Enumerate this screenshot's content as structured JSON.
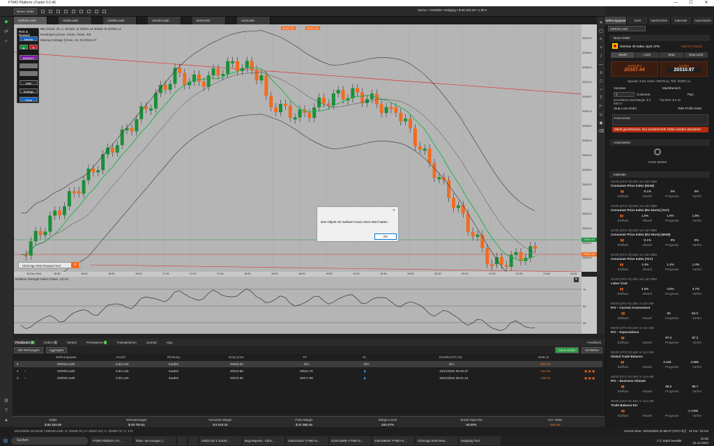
{
  "window": {
    "title": "FTMO Platform cTrader 5.0.46",
    "minimize": "—",
    "maximize": "☐",
    "close": "✕"
  },
  "toolbar": {
    "new_order": "Neuer Order",
    "account": "Demo • 7322556 • Hedging • $ 50 263.49 • 1:30 ▾"
  },
  "chart_tabs": [
    "GER40.cash",
    "US30.cash",
    "US500.cash",
    "US100.cash",
    "EURUSD",
    "XAUUSD"
  ],
  "chart": {
    "legend1": "BB (Close, 20, 2, Simple, 0)  20321.44  20350.75  20292.14",
    "legend2": "Envelopes (Close, Close, Close, 20)",
    "legend3": "Moving Average (Close, 14, 0)  20315.47",
    "price_labels": [
      "20392.0",
      "20386.0",
      "20380.0",
      "20374.0",
      "20368.0",
      "20362.0",
      "20356.0",
      "20350.0",
      "20344.0",
      "20338.0",
      "20332.0",
      "20326.0",
      "20320.0",
      "20314.0",
      "20308.0",
      "20302.0"
    ],
    "time_labels": [
      "16 Dec 2024",
      "15:45",
      "16:05",
      "16:25",
      "16:45",
      "17:05",
      "17:25",
      "17:45",
      "18:05",
      "18:25",
      "18:45",
      "19:05",
      "19:25",
      "19:45",
      "20:05",
      "20:25",
      "20:45",
      "21:05",
      "21:25",
      "21:45",
      "22:05"
    ],
    "bid_tag": "20307.44",
    "ask_tag": "20310.97",
    "top_tag1": "20367.42",
    "top_tag2": "20310.00"
  },
  "risk_reward": {
    "title": "Risk & Reward",
    "buttons": [
      "Market",
      "▲",
      "▼",
      "MARKET",
      "",
      "",
      "Hide",
      "Settings",
      "Close"
    ]
  },
  "overlay": {
    "label": "ClickAlgo Risk Reward Tool",
    "close": "✕"
  },
  "rsi": {
    "title": "Relative Strength Index (Close, 14)  51",
    "labels": [
      "70",
      "50",
      "30"
    ]
  },
  "dialog": {
    "message": "Das Objekt mit Nullwert muss einen Wert haben.",
    "ok": "OK",
    "close": "✕"
  },
  "bottom_tabs": [
    {
      "label": "Positionen",
      "badge": "3"
    },
    {
      "label": "Orders",
      "badge": "0"
    },
    {
      "label": "Verlauf",
      "badge": ""
    },
    {
      "label": "Preisalarme",
      "badge": "2"
    },
    {
      "label": "Transaktionen",
      "badge": ""
    },
    {
      "label": "Journal",
      "badge": ""
    },
    {
      "label": "Algo",
      "badge": ""
    }
  ],
  "feedback": "Feedback",
  "filters": {
    "direction": "Alle Richtungen",
    "grouping": "Aggregiert",
    "new_order": "Neue Order",
    "close": "Schließen"
  },
  "positions": {
    "headers": [
      "Währungspaar",
      "Anzahl",
      "Richtung",
      "Entry price",
      "TP",
      "SL",
      "Erstellt (UTC+0)",
      "Netto $"
    ],
    "rows": [
      [
        "GER40.cash",
        "5.60 Lots",
        "Kaufen",
        "20403.04",
        "N/A",
        "N/A",
        "N/A",
        "-962.06"
      ],
      [
        "GER40.cash",
        "3.60 Lots",
        "Kaufen",
        "20419.68",
        "20521.76",
        "",
        "16/12/2024 05:45:37",
        "-424.66"
      ],
      [
        "GER40.cash",
        "2.00 Lots",
        "Kaufen",
        "20373.06",
        "20477.99",
        "",
        "16/12/2024 08:01:44",
        "-138.03"
      ]
    ]
  },
  "footer": {
    "labels": [
      "Saldo",
      "Reinvermögen",
      "Genutzte Margin",
      "Freie Margin",
      "Margin-Level",
      "Smart Stop-Out",
      "Unr. Netto"
    ],
    "values": [
      "$ 50 263.49",
      "$ 49 700.61",
      "$ 8 010.16",
      "$ 41 690.45",
      "620.47%",
      "50.00%",
      "-562.88"
    ]
  },
  "status": "16/12/2024 16:15:50 | GER40.cash: O: 20349.75 | H: 20347.23 | C: 20348.73 | V: 172",
  "current_time": "Current time: 16/12/2024 21:55:47 (UTC+0)  ▏ 12 ms / 16 ms",
  "right_panel": {
    "tabs": [
      "Währungspaar",
      "DoM",
      "Nachrichten",
      "Kalender",
      "Autochartist"
    ],
    "symbol": "GER40.cash",
    "new_order": "Neue Order",
    "instrument": "German 40 Index, Spot CFD",
    "change": "-102.0 (-0.51%)",
    "order_types": [
      "Markt",
      "Limit",
      "Stop",
      "Stop-Limit"
    ],
    "sell_label": "Verkaufen",
    "sell_price": "20307.44",
    "buy_label": "Kaufen",
    "buy_price": "20310.97",
    "spread": "Spread: 3.53, Hoch: 20479.xx, Tief: 20297.xx",
    "volume_label": "Volumen",
    "volume": "2",
    "volume_unit": "Contracts",
    "pips_label": "Pips",
    "market_range": "Marktbereich",
    "margin_line": "Geschätzte Kauf-Margin: $ 2 845.47",
    "pip_value": "Pip-Wert: $ 2.10",
    "stop_loss": "Stop-Loss-Order",
    "take_profit": "Take-Profit-Order",
    "comment_label": "Kommentar",
    "market_closed": "Markt geschlossen. Nur ausstehende Order werden akzeptiert.",
    "autochartist": "Autochartist",
    "no_pattern": "Keine Muster",
    "calendar": "Kalender",
    "events": [
      {
        "time": "10:00 (UTC+0) Zeit: vor 11h 55M",
        "name": "Consumer Price Index (MoM)",
        "v": [
          "-0.1%",
          "0%",
          "0%"
        ]
      },
      {
        "time": "10:00 (UTC+0) Zeit: vor 11h 55M",
        "name": "Consumer Price Index (EU Norm) (YoY)",
        "v": [
          "1.5%",
          "1.6%",
          "1.8%"
        ]
      },
      {
        "time": "10:00 (UTC+0) Zeit: vor 11h 55M",
        "name": "Consumer Price Index (EU Norm) (MoM)",
        "v": [
          "-0.1%",
          "0%",
          "0%"
        ]
      },
      {
        "time": "10:00 (UTC+0) Zeit: vor 11h 55M",
        "name": "Consumer Price Index (YoY)",
        "v": [
          "1.4%",
          "1.4%",
          "1.4%"
        ]
      },
      {
        "time": "10:00 (UTC+0) Zeit: vor 11h 55M",
        "name": "Labor Cost",
        "v": [
          "4.6%",
          "4.6%",
          "4.7%"
        ]
      },
      {
        "time": "09:00 (UTC+0) Zeit: in 11H 4M",
        "name": "IFO – Current Assessment",
        "v": [
          "",
          "84",
          "84.3"
        ]
      },
      {
        "time": "09:00 (UTC+0) Zeit: in 11H 4M",
        "name": "IFO – Expectations",
        "v": [
          "",
          "87.5",
          "87.2"
        ]
      },
      {
        "time": "09:00 (UTC+0) Zeit: in 11H 4M",
        "name": "Global Trade Balance",
        "v": [
          "",
          "3.22€",
          "2.58€"
        ]
      },
      {
        "time": "09:00 (UTC+0) Zeit: in 11H 4M",
        "name": "IFO – Business Climate",
        "v": [
          "",
          "85.6",
          "85.7"
        ]
      },
      {
        "time": "09:00 (UTC+0) Zeit: in 11H 4M",
        "name": "Trade Balance EU",
        "v": [
          "",
          "",
          "-1.175€"
        ]
      }
    ],
    "cal_cols": [
      "Einfluss",
      "Aktuell",
      "Prognose",
      "Vorher"
    ]
  },
  "taskbar": {
    "search": "Suchen",
    "items": [
      "FTMO Platform cTr...",
      "#dax- am-morgen |...",
      "",
      "",
      "USDCAD 1.42420 ...",
      "Bug Reports - Click...",
      "430144343: FTMO-S...",
      "410014909: FTMO-S...",
      "430159849: FTMO-S...",
      "ClickAlgo Risk Rew...",
      "Snipping Tool"
    ],
    "weather": "1°C  Stark bewölkt",
    "clock_time": "22:55",
    "clock_date": "16.12.2024"
  },
  "colors": {
    "bull": "#1a8f3a",
    "bear": "#f26b21",
    "ma": "#18b04a",
    "bb": "#333333",
    "accent_green": "#2f9e44"
  }
}
